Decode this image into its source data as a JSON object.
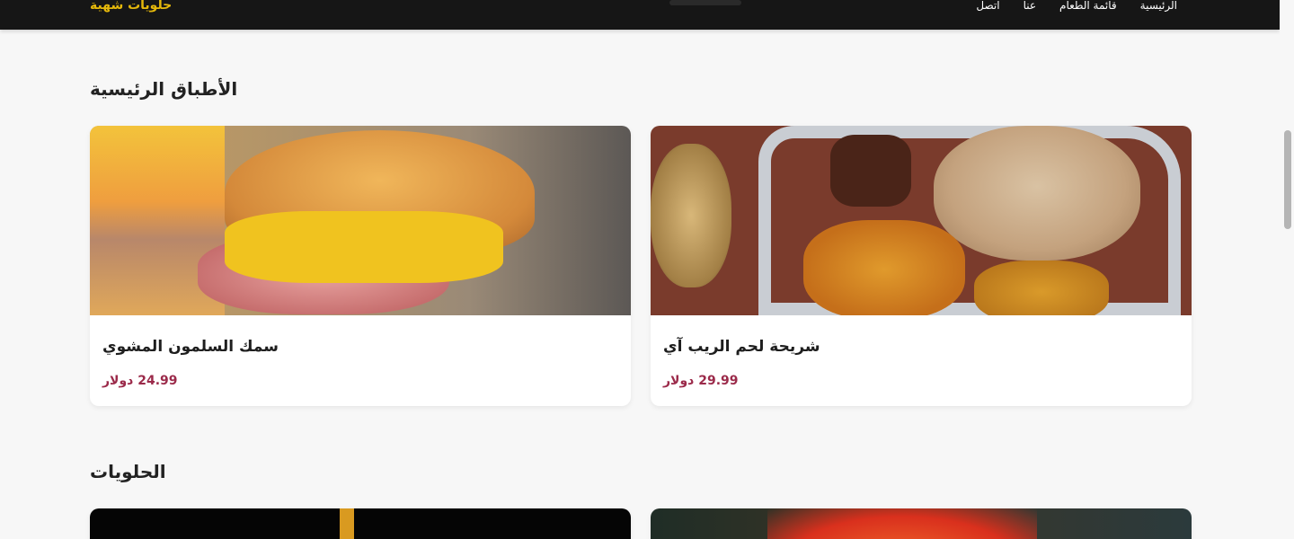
{
  "header": {
    "brand": "حلويات شهية",
    "nav": [
      "الرئيسية",
      "قائمة الطعام",
      "عنا",
      "اتصل"
    ]
  },
  "sections": [
    {
      "title": "الأطباق الرئيسية",
      "items": [
        {
          "name": "شريحة لحم الريب آي",
          "price": "29.99 دولار"
        },
        {
          "name": "سمك السلمون المشوي",
          "price": "24.99 دولار"
        }
      ]
    },
    {
      "title": "الحلويات"
    }
  ]
}
